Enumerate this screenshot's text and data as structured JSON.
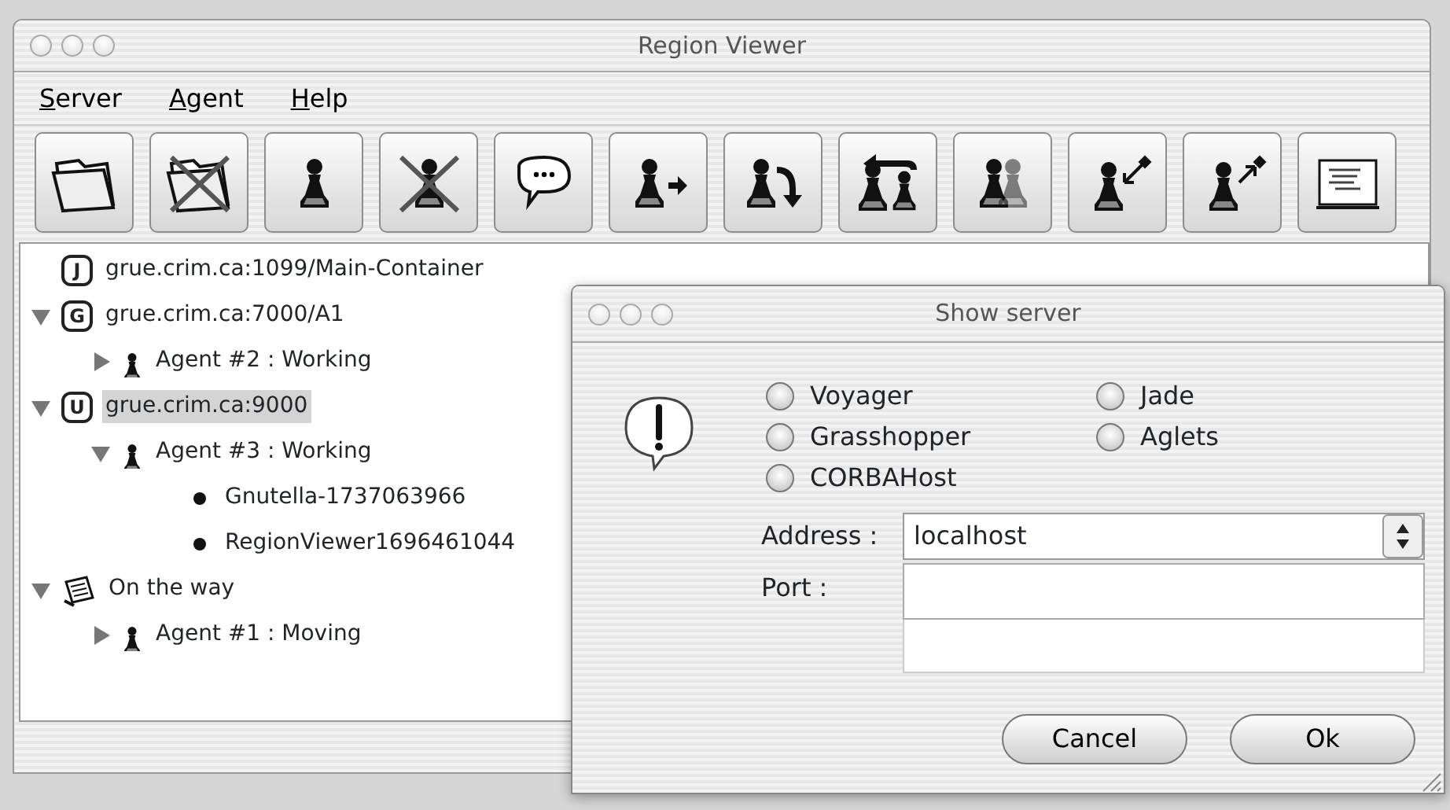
{
  "window": {
    "title": "Region Viewer"
  },
  "menu": [
    {
      "label": "Server"
    },
    {
      "label": "Agent"
    },
    {
      "label": "Help"
    }
  ],
  "toolbar": [
    {
      "kind": "folder"
    },
    {
      "kind": "folder-crossed"
    },
    {
      "kind": "pawn"
    },
    {
      "kind": "pawn-crossed"
    },
    {
      "kind": "speech"
    },
    {
      "kind": "pawn-arrow-right"
    },
    {
      "kind": "pawn-arrow-down"
    },
    {
      "kind": "pawn-loop"
    },
    {
      "kind": "pawn-pair"
    },
    {
      "kind": "pawn-arrow-in"
    },
    {
      "kind": "pawn-arrow-out"
    },
    {
      "kind": "screen"
    }
  ],
  "tree": [
    {
      "kind": "server",
      "badge": "J",
      "label": "grue.crim.ca:1099/Main-Container",
      "selected": false
    },
    {
      "kind": "server",
      "badge": "G",
      "label": "grue.crim.ca:7000/A1",
      "selected": false,
      "expanded": true,
      "children": [
        {
          "kind": "agent",
          "label": "Agent #2 : Working",
          "selected": false,
          "expanded": false
        }
      ]
    },
    {
      "kind": "server",
      "badge": "U",
      "label": "grue.crim.ca:9000",
      "selected": true,
      "expanded": true,
      "children": [
        {
          "kind": "agent",
          "label": "Agent #3 : Working",
          "selected": false,
          "expanded": true,
          "children": [
            {
              "kind": "object",
              "label": "Gnutella-1737063966",
              "selected": false
            },
            {
              "kind": "object",
              "label": "RegionViewer1696461044",
              "selected": false
            }
          ]
        }
      ]
    },
    {
      "kind": "transit",
      "label": "On the way",
      "selected": false,
      "expanded": true,
      "children": [
        {
          "kind": "agent",
          "label": "Agent #1 : Moving",
          "selected": false,
          "expanded": false
        }
      ]
    }
  ],
  "dialog": {
    "title": "Show server",
    "options": [
      {
        "label": "Voyager",
        "selected": false
      },
      {
        "label": "Jade",
        "selected": false
      },
      {
        "label": "Grasshopper",
        "selected": false
      },
      {
        "label": "Aglets",
        "selected": false
      },
      {
        "label": "CORBAHost",
        "selected": false
      }
    ],
    "address": {
      "label": "Address :",
      "value": "localhost"
    },
    "port": {
      "label": "Port :"
    },
    "buttons": [
      {
        "label": "Cancel"
      },
      {
        "label": "Ok"
      }
    ]
  }
}
